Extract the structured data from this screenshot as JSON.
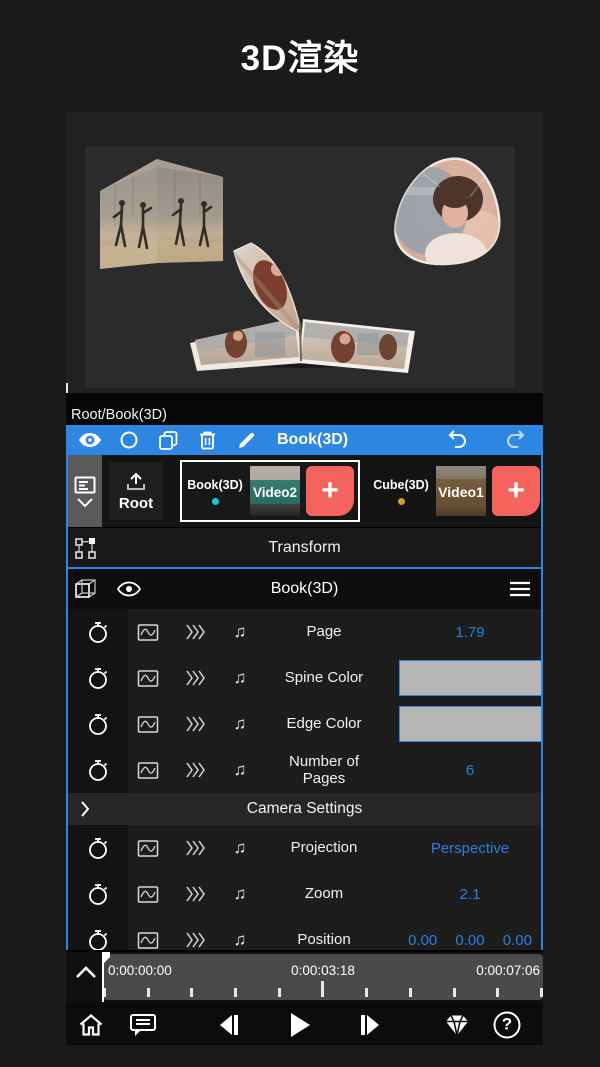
{
  "page": {
    "title": "3D渲染"
  },
  "preview": {
    "breadcrumb": "Root/Book(3D)"
  },
  "toolbar": {
    "title": "Book(3D)"
  },
  "layer_strip": {
    "root_label": "Root",
    "groups": [
      {
        "name": "Book(3D)",
        "clip": "Video2",
        "dot_color": "#1fc3d6",
        "selected": true
      },
      {
        "name": "Cube(3D)",
        "clip": "Video1",
        "dot_color": "#d69a2e",
        "selected": false
      }
    ]
  },
  "transform": {
    "label": "Transform"
  },
  "panel": {
    "title": "Book(3D)",
    "rows": [
      {
        "label": "Page",
        "value": "1.79"
      },
      {
        "label": "Spine Color",
        "swatch": "#b6b6b6"
      },
      {
        "label": "Edge Color",
        "swatch": "#b6b6b6"
      },
      {
        "label": "Number of Pages",
        "value": "6"
      },
      {
        "label": "Camera Settings"
      },
      {
        "label": "Projection",
        "value": "Perspective"
      },
      {
        "label": "Zoom",
        "value": "2.1"
      },
      {
        "label": "Position",
        "values": [
          "0.00",
          "0.00",
          "0.00"
        ]
      }
    ]
  },
  "timeline": {
    "start": "0:00:00:00",
    "middle": "0:00:03:18",
    "end": "0:00:07:06"
  },
  "icons": {
    "note": "♫",
    "help": "?",
    "plus": "+"
  },
  "colors": {
    "accent_blue": "#2e86e3",
    "value_blue": "#2b7de0",
    "add_button_red": "#f4645c",
    "swatch_gray": "#b6b6b6",
    "book_dot_cyan": "#1fc3d6",
    "cube_dot_orange": "#d69a2e",
    "selected_border": "#ffffff"
  }
}
